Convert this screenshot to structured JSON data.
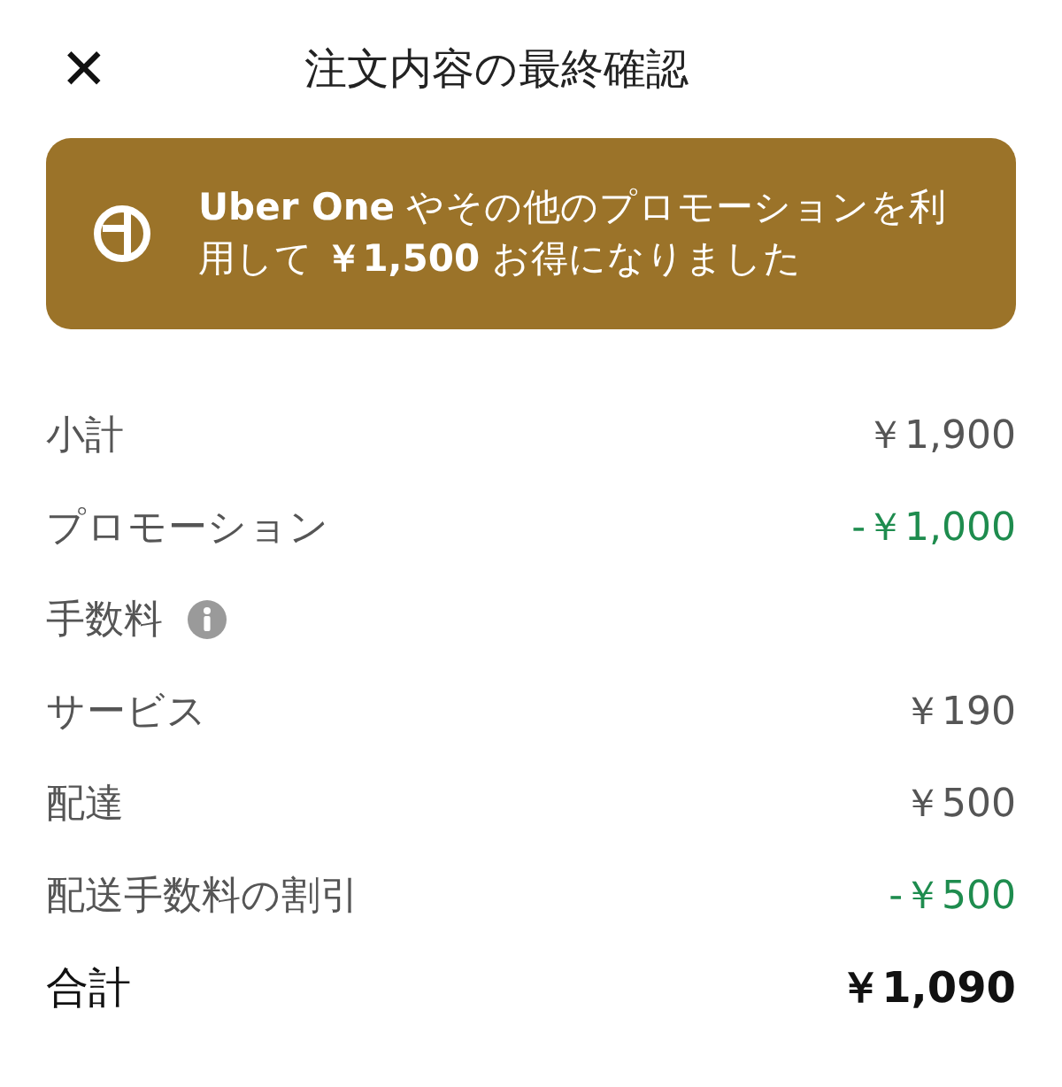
{
  "header": {
    "close": "✕",
    "title": "注文内容の最終確認"
  },
  "banner": {
    "text": "**Uber One** やその他のプロモーションを利用して **￥1,500** お得になりました"
  },
  "rows": [
    {
      "kind": "item",
      "label": "小計",
      "amount": "￥1,900",
      "discount": false
    },
    {
      "kind": "item",
      "label": "プロモーション",
      "amount": "-￥1,000",
      "discount": true
    },
    {
      "kind": "heading",
      "label": "手数料"
    },
    {
      "kind": "item",
      "label": "サービス",
      "amount": "￥190",
      "discount": false
    },
    {
      "kind": "item",
      "label": "配達",
      "amount": "￥500",
      "discount": false
    },
    {
      "kind": "item",
      "label": "配送手数料の割引",
      "amount": "-￥500",
      "discount": true
    },
    {
      "kind": "total",
      "label": "合計",
      "amount": "￥1,090"
    }
  ]
}
